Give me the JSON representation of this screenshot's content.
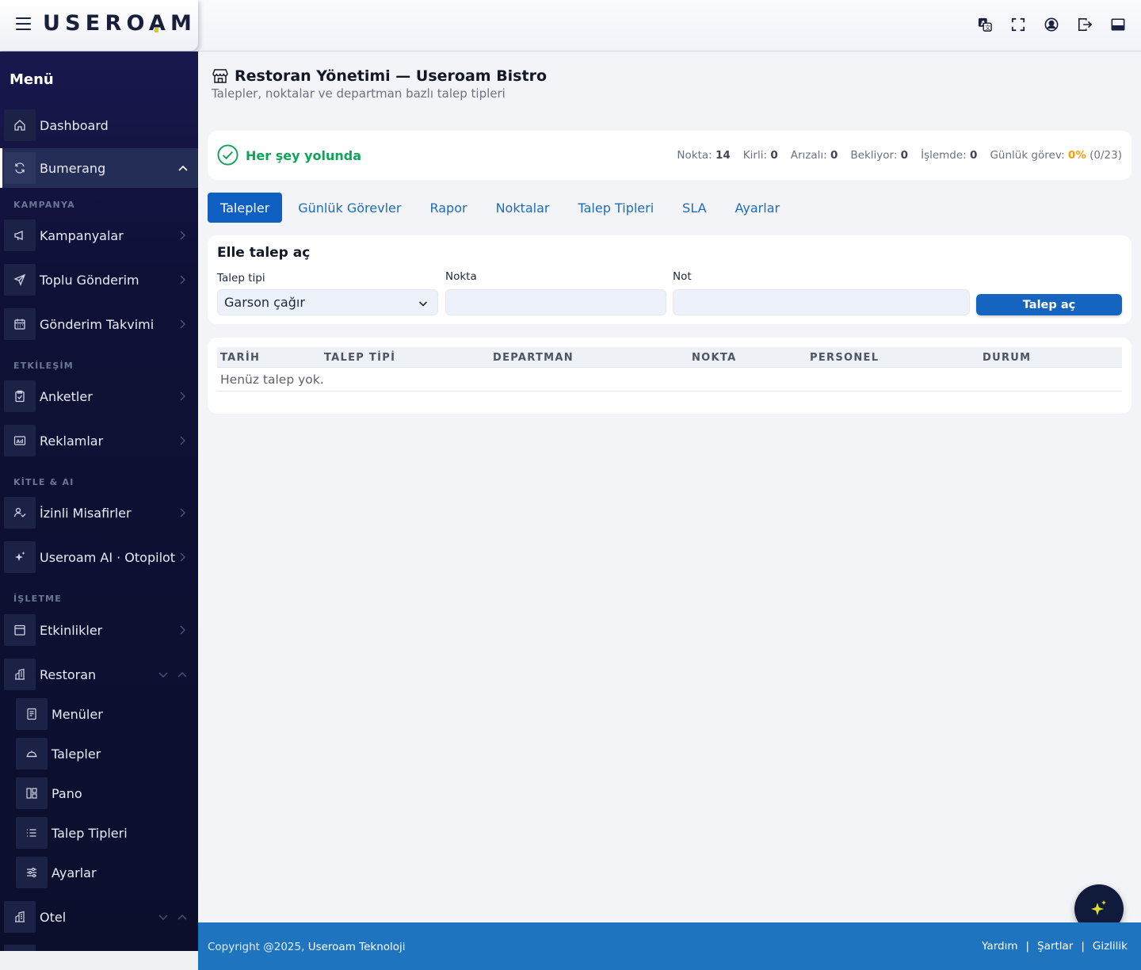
{
  "header": {
    "logo": "USEROAM",
    "icons": [
      "translate-icon",
      "fullscreen-icon",
      "user-circle-icon",
      "logout-icon",
      "panel-icon"
    ]
  },
  "sidebar": {
    "title": "Menü",
    "dashboard": "Dashboard",
    "bumerang": "Bumerang",
    "sections": {
      "kampanya": "KAMPANYA",
      "etkilesim": "ETKİLEŞİM",
      "kitle": "KİTLE & AI",
      "isletme": "İŞLETME"
    },
    "items": {
      "kampanyalar": "Kampanyalar",
      "toplu": "Toplu Gönderim",
      "takvim": "Gönderim Takvimi",
      "anketler": "Anketler",
      "reklamlar": "Reklamlar",
      "izinli": "İzinli Misafirler",
      "ai": "Useroam AI · Otopilot",
      "etkinlikler": "Etkinlikler",
      "restoran": "Restoran",
      "otel": "Otel"
    },
    "restoran_sub": {
      "menuler": "Menüler",
      "talepler": "Talepler",
      "pano": "Pano",
      "talep_tipleri": "Talep Tipleri",
      "ayarlar": "Ayarlar"
    }
  },
  "page": {
    "title": "Restoran Yönetimi — Useroam Bistro",
    "subtitle": "Talepler, noktalar ve departman bazlı talep tipleri"
  },
  "status": {
    "message": "Her şey yolunda",
    "nokta_label": "Nokta:",
    "nokta": "14",
    "kirli_label": "Kirli:",
    "kirli": "0",
    "arizali_label": "Arızalı:",
    "arizali": "0",
    "bekliyor_label": "Bekliyor:",
    "bekliyor": "0",
    "islemde_label": "İşlemde:",
    "islemde": "0",
    "gorev_label": "Günlük görev:",
    "gorev_pct": "0%",
    "gorev_ratio": "(0/23)",
    "ok_color": "#10a45b",
    "pct_color": "#f59e0b"
  },
  "tabs": [
    "Talepler",
    "Günlük Görevler",
    "Rapor",
    "Noktalar",
    "Talep Tipleri",
    "SLA",
    "Ayarlar"
  ],
  "active_tab": "Talepler",
  "form": {
    "title": "Elle talep aç",
    "type_label": "Talep tipi",
    "type_value": "Garson çağır",
    "point_label": "Nokta",
    "point_value": "",
    "note_label": "Not",
    "note_value": "",
    "submit": "Talep aç"
  },
  "table": {
    "columns": [
      "TARİH",
      "TALEP TİPİ",
      "DEPARTMAN",
      "NOKTA",
      "PERSONEL",
      "DURUM"
    ],
    "rows": [],
    "empty": "Henüz talep yok."
  },
  "footer": {
    "copyright": "Copyright @2025,",
    "company": "Useroam Teknoloji",
    "links": [
      "Yardım",
      "Şartlar",
      "Gizlilik"
    ],
    "bg": "#1f74c0"
  },
  "colors": {
    "accent": "#0f5ec2",
    "sidebar_bg": "#0b0f2c"
  }
}
